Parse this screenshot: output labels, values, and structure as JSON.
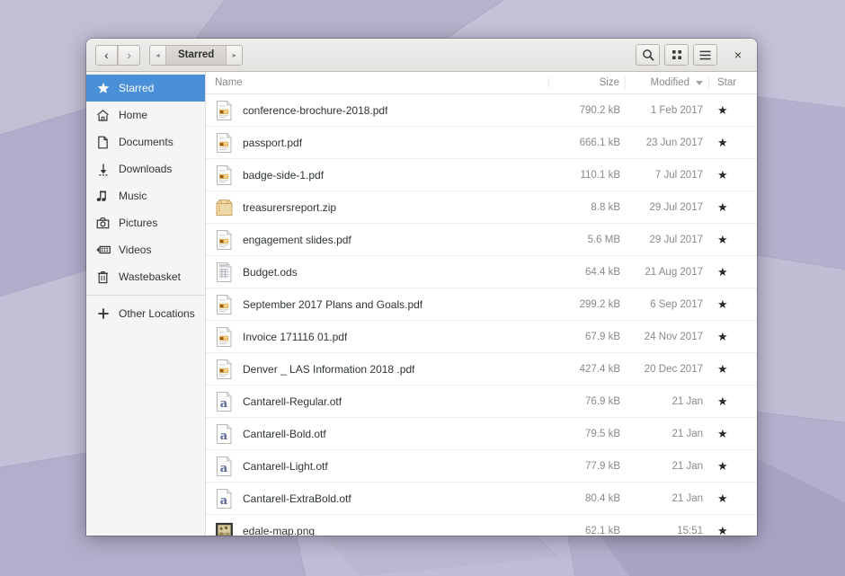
{
  "window": {
    "title": "Starred",
    "nav": {
      "back_label": "‹",
      "forward_label": "›",
      "path_prev_label": "◂",
      "path_next_label": "▸",
      "crumb_label": "Starred"
    },
    "actions": {
      "search_label": "⌕",
      "grid_view_label": "grid",
      "menu_label": "≡",
      "close_label": "×"
    },
    "colors": {
      "selection": "#4a90d9",
      "headerbar": "#e8e6e3",
      "sidebar": "#f6f5f4",
      "wallpaper": "#b8b2cc"
    }
  },
  "sidebar": {
    "items": [
      {
        "label": "Starred",
        "icon": "star-icon",
        "selected": true
      },
      {
        "label": "Home",
        "icon": "home-icon",
        "selected": false
      },
      {
        "label": "Documents",
        "icon": "document-icon",
        "selected": false
      },
      {
        "label": "Downloads",
        "icon": "download-icon",
        "selected": false
      },
      {
        "label": "Music",
        "icon": "music-icon",
        "selected": false
      },
      {
        "label": "Pictures",
        "icon": "camera-icon",
        "selected": false
      },
      {
        "label": "Videos",
        "icon": "video-icon",
        "selected": false
      },
      {
        "label": "Wastebasket",
        "icon": "trash-icon",
        "selected": false
      }
    ],
    "other": {
      "label": "Other Locations",
      "icon": "plus-icon"
    }
  },
  "filelist": {
    "columns": {
      "name": "Name",
      "size": "Size",
      "modified": "Modified",
      "star": "Star"
    },
    "sort": {
      "column": "Modified",
      "direction": "descending"
    },
    "star_glyph": "★",
    "rows": [
      {
        "name": "conference-brochure-2018.pdf",
        "size": "790.2 kB",
        "modified": "1 Feb 2017",
        "starred": true,
        "icon": "pdf-icon"
      },
      {
        "name": "passport.pdf",
        "size": "666.1 kB",
        "modified": "23 Jun 2017",
        "starred": true,
        "icon": "pdf-icon"
      },
      {
        "name": "badge-side-1.pdf",
        "size": "110.1 kB",
        "modified": "7 Jul 2017",
        "starred": true,
        "icon": "pdf-icon"
      },
      {
        "name": "treasurersreport.zip",
        "size": "8.8 kB",
        "modified": "29 Jul 2017",
        "starred": true,
        "icon": "archive-icon"
      },
      {
        "name": "engagement slides.pdf",
        "size": "5.6 MB",
        "modified": "29 Jul 2017",
        "starred": true,
        "icon": "pdf-icon"
      },
      {
        "name": "Budget.ods",
        "size": "64.4 kB",
        "modified": "21 Aug 2017",
        "starred": true,
        "icon": "spreadsheet-icon"
      },
      {
        "name": "September 2017 Plans and Goals.pdf",
        "size": "299.2 kB",
        "modified": "6 Sep 2017",
        "starred": true,
        "icon": "pdf-icon"
      },
      {
        "name": "Invoice 171116  01.pdf",
        "size": "67.9 kB",
        "modified": "24 Nov 2017",
        "starred": true,
        "icon": "pdf-icon"
      },
      {
        "name": "Denver _ LAS Information 2018 .pdf",
        "size": "427.4 kB",
        "modified": "20 Dec 2017",
        "starred": true,
        "icon": "pdf-icon"
      },
      {
        "name": "Cantarell-Regular.otf",
        "size": "76.9 kB",
        "modified": "21 Jan",
        "starred": true,
        "icon": "font-icon"
      },
      {
        "name": "Cantarell-Bold.otf",
        "size": "79.5 kB",
        "modified": "21 Jan",
        "starred": true,
        "icon": "font-icon"
      },
      {
        "name": "Cantarell-Light.otf",
        "size": "77.9 kB",
        "modified": "21 Jan",
        "starred": true,
        "icon": "font-icon"
      },
      {
        "name": "Cantarell-ExtraBold.otf",
        "size": "80.4 kB",
        "modified": "21 Jan",
        "starred": true,
        "icon": "font-icon"
      },
      {
        "name": "edale-map.png",
        "size": "62.1 kB",
        "modified": "15:51",
        "starred": true,
        "icon": "image-icon"
      }
    ]
  }
}
